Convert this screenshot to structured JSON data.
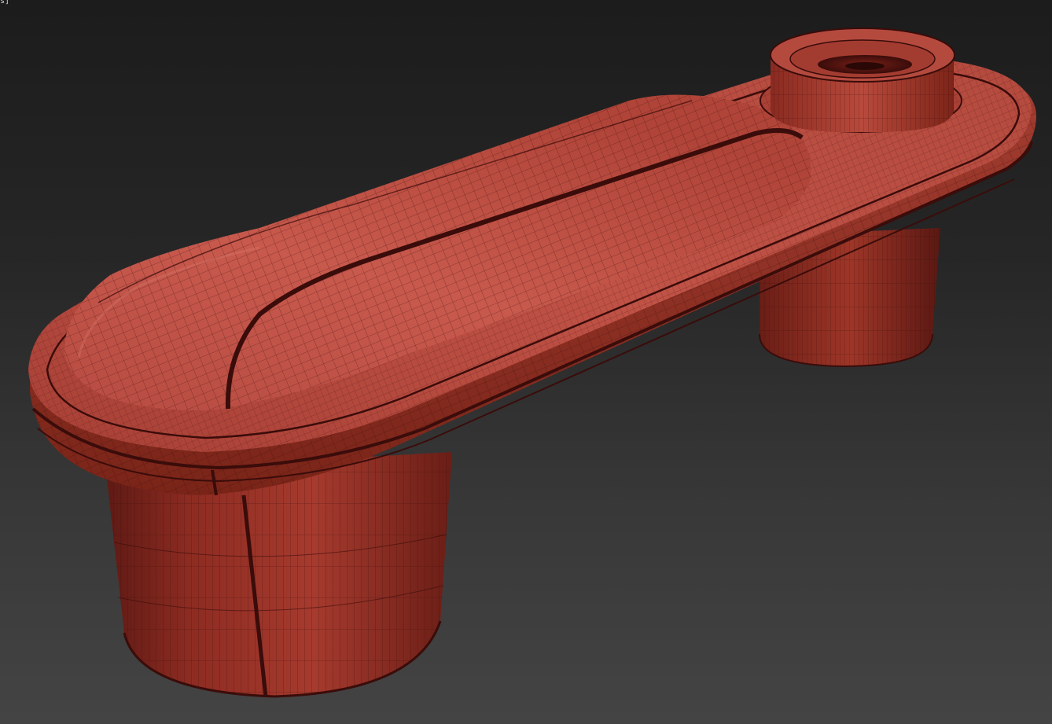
{
  "viewport": {
    "label": "s]",
    "render_mode": "shaded-wireframe",
    "background": "gradient-dark-gray"
  },
  "model": {
    "object": "window-crank-handle",
    "colors": {
      "base": "#b5483c",
      "highlight": "#c85a4c",
      "shadow": "#5a1614",
      "wire": "#3a0c0a"
    }
  }
}
